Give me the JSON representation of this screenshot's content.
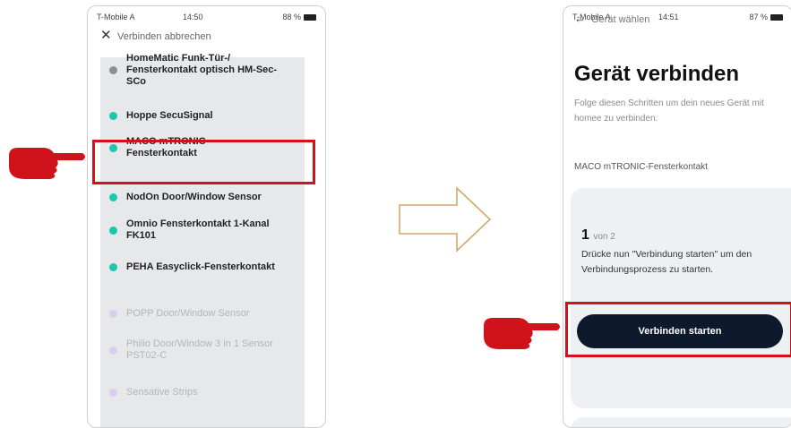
{
  "left_screen": {
    "status": {
      "carrier": "T-Mobile A",
      "time": "14:50",
      "battery": "88 %"
    },
    "header": {
      "close_icon": "close-icon",
      "cancel_label": "Verbinden abbrechen"
    },
    "items": [
      {
        "label": "HomeMatic Funk-Tür-/ Fensterkontakt optisch HM-Sec-SCo",
        "state": "grey"
      },
      {
        "label": "Hoppe SecuSignal",
        "state": "active"
      },
      {
        "label": "MACO mTRONIC-Fensterkontakt",
        "state": "active"
      },
      {
        "label": "NodOn Door/Window Sensor",
        "state": "active"
      },
      {
        "label": "Omnio Fensterkontakt 1-Kanal FK101",
        "state": "active"
      },
      {
        "label": "PEHA Easyclick-Fensterkontakt",
        "state": "active"
      },
      {
        "label": "POPP Door/Window Sensor",
        "state": "faded"
      },
      {
        "label": "Philio Door/Window 3 in 1 Sensor PST02-C",
        "state": "faded"
      },
      {
        "label": "Sensative Strips",
        "state": "faded"
      }
    ]
  },
  "right_screen": {
    "status": {
      "carrier": "T-Mobile A",
      "time": "14:51",
      "battery": "87 %"
    },
    "back_label": "Gerät wählen",
    "title": "Gerät verbinden",
    "description": "Folge diesen Schritten um dein neues Gerät mit homee zu verbinden:",
    "device_name": "MACO mTRONIC-Fensterkontakt",
    "step": {
      "current": "1",
      "of_label": "von 2"
    },
    "instruction": "Drücke nun \"Verbindung starten\" um den Verbindungsprozess zu starten.",
    "cta_label": "Verbinden starten"
  },
  "annotations": {
    "highlight_color": "#d0121b",
    "hand_icon": "pointing-hand-icon",
    "arrow_icon": "right-arrow-icon",
    "accent_teal": "#18c9ad",
    "button_navy": "#0d1a2e"
  }
}
